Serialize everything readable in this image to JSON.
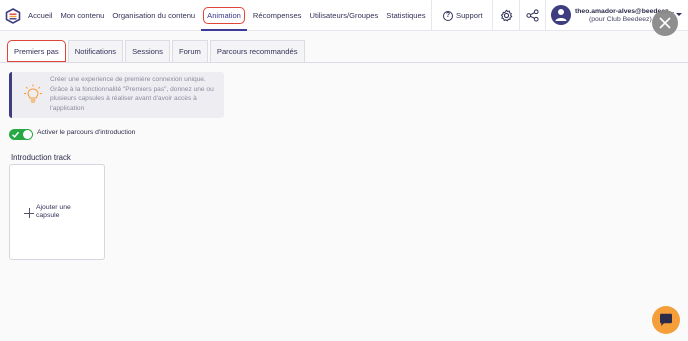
{
  "nav": {
    "items": [
      {
        "label": "Accueil"
      },
      {
        "label": "Mon contenu"
      },
      {
        "label": "Organisation du contenu"
      },
      {
        "label": "Animation"
      },
      {
        "label": "Récompenses"
      },
      {
        "label": "Utilisateurs/Groupes"
      },
      {
        "label": "Statistiques"
      }
    ],
    "active": "Animation"
  },
  "header": {
    "support_label": "Support",
    "user_name": "theo.amador-alves@beedeez...",
    "user_org": "(pour Club Beedeez)"
  },
  "tabs": [
    {
      "label": "Premiers pas"
    },
    {
      "label": "Notifications"
    },
    {
      "label": "Sessions"
    },
    {
      "label": "Forum"
    },
    {
      "label": "Parcours recommandés"
    }
  ],
  "info": {
    "text": "Créer une experience de première connexion unique. Grâce à la fonctionnalité \"Premiers pas\", donnez une ou plusieurs capsules à réaliser avant d'avoir accès à l'application"
  },
  "toggle": {
    "label": "Activer le parcours d'introduction",
    "on": true
  },
  "track": {
    "title": "Introduction track",
    "add_label": "Ajouter une capsule"
  },
  "colors": {
    "accent": "#3d3d80",
    "highlight": "#e0453a",
    "toggle_on": "#27a844",
    "chat": "#f59f3a"
  }
}
